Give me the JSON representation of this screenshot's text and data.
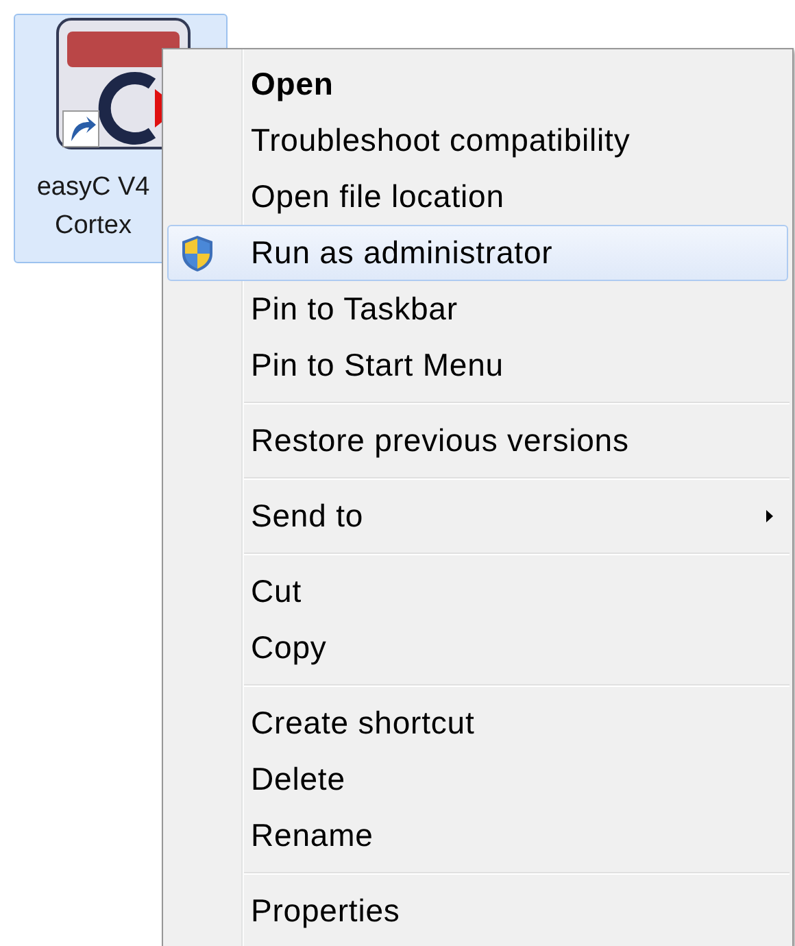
{
  "desktop_icon": {
    "label_lines": [
      "easyC V4",
      "Cortex"
    ],
    "selected": true
  },
  "context_menu": {
    "items": [
      {
        "kind": "item",
        "label": "Open",
        "default": true,
        "selected": false,
        "submenu": false
      },
      {
        "kind": "item",
        "label": "Troubleshoot compatibility",
        "default": false,
        "selected": false,
        "submenu": false
      },
      {
        "kind": "item",
        "label": "Open file location",
        "default": false,
        "selected": false,
        "submenu": false
      },
      {
        "kind": "shield_item",
        "label": "Run as administrator",
        "default": false,
        "selected": true,
        "submenu": false
      },
      {
        "kind": "item",
        "label": "Pin to Taskbar",
        "default": false,
        "selected": false,
        "submenu": false
      },
      {
        "kind": "item",
        "label": "Pin to Start Menu",
        "default": false,
        "selected": false,
        "submenu": false
      },
      {
        "kind": "separator"
      },
      {
        "kind": "item",
        "label": "Restore previous versions",
        "default": false,
        "selected": false,
        "submenu": false
      },
      {
        "kind": "separator"
      },
      {
        "kind": "item",
        "label": "Send to",
        "default": false,
        "selected": false,
        "submenu": true
      },
      {
        "kind": "separator"
      },
      {
        "kind": "item",
        "label": "Cut",
        "default": false,
        "selected": false,
        "submenu": false
      },
      {
        "kind": "item",
        "label": "Copy",
        "default": false,
        "selected": false,
        "submenu": false
      },
      {
        "kind": "separator"
      },
      {
        "kind": "item",
        "label": "Create shortcut",
        "default": false,
        "selected": false,
        "submenu": false
      },
      {
        "kind": "item",
        "label": "Delete",
        "default": false,
        "selected": false,
        "submenu": false
      },
      {
        "kind": "item",
        "label": "Rename",
        "default": false,
        "selected": false,
        "submenu": false
      },
      {
        "kind": "separator"
      },
      {
        "kind": "item",
        "label": "Properties",
        "default": false,
        "selected": false,
        "submenu": false
      }
    ]
  }
}
